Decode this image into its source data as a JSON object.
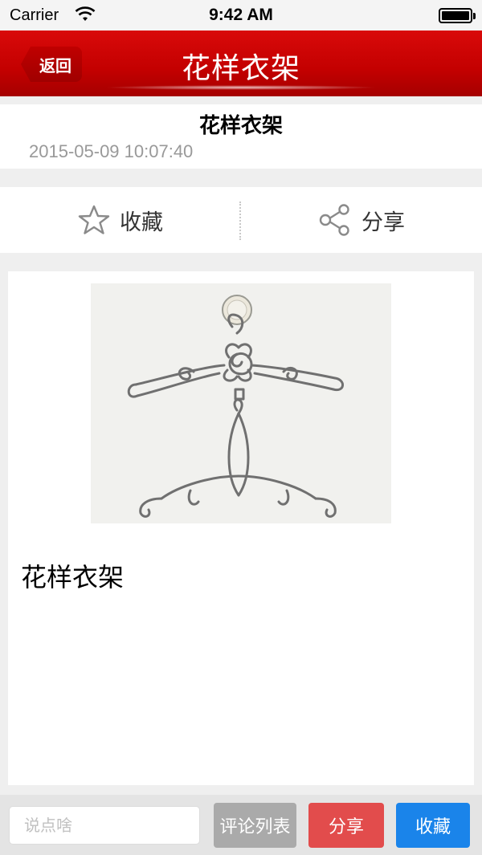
{
  "status_bar": {
    "carrier": "Carrier",
    "time": "9:42 AM"
  },
  "nav": {
    "back_label": "返回",
    "title": "花样衣架"
  },
  "article": {
    "title": "花样衣架",
    "date": "2015-05-09 10:07:40",
    "body_text": "花样衣架"
  },
  "actions": {
    "favorite_label": "收藏",
    "share_label": "分享"
  },
  "bottom_bar": {
    "comment_placeholder": "说点啥",
    "comment_list_label": "评论列表",
    "share_label": "分享",
    "favorite_label": "收藏"
  },
  "colors": {
    "nav_red": "#c30000",
    "share_red": "#e24c4c",
    "favorite_blue": "#1a84ea",
    "comment_list_gray": "#aaaaaa"
  },
  "icons": {
    "favorite": "star-outline-icon",
    "share": "share-nodes-icon"
  }
}
